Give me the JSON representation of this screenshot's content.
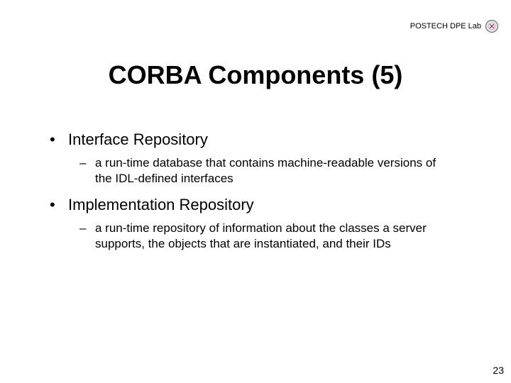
{
  "header": {
    "label": "POSTECH DPE Lab"
  },
  "title": "CORBA Components (5)",
  "bullets": [
    {
      "text": "Interface Repository",
      "sub": "a run-time database that contains machine-readable versions of the IDL-defined interfaces"
    },
    {
      "text": "Implementation Repository",
      "sub": "a run-time repository of information about the classes a server supports, the objects that are instantiated, and their IDs"
    }
  ],
  "pageNumber": "23"
}
